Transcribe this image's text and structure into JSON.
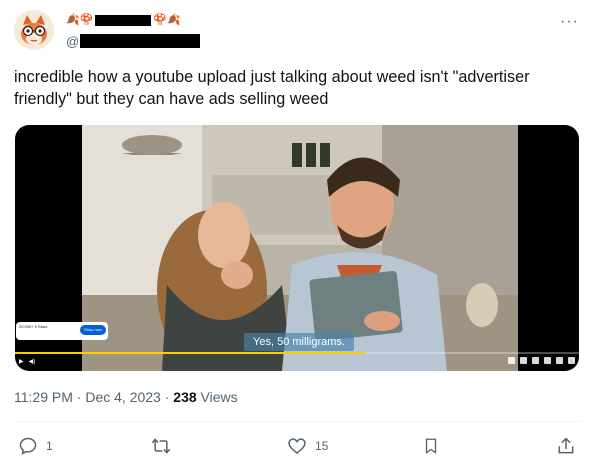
{
  "author": {
    "handle_prefix": "@"
  },
  "tweet": {
    "text": "incredible how a youtube upload just talking about weed isn't \"advertiser friendly\" but they can have ads selling weed",
    "time": "11:29 PM",
    "date": "Dec 4, 2023",
    "views": "238",
    "views_label": "Views"
  },
  "video": {
    "caption": "Yes, 50 milligrams.",
    "progress": 0.62,
    "ad": {
      "title": "29,000+ 5 Stars",
      "button": "Shop now"
    }
  },
  "actions": {
    "replies": "1",
    "likes": "15"
  },
  "colors": {
    "text": "#0f1419",
    "muted": "#536471",
    "accent_progress": "#ffcc00"
  }
}
